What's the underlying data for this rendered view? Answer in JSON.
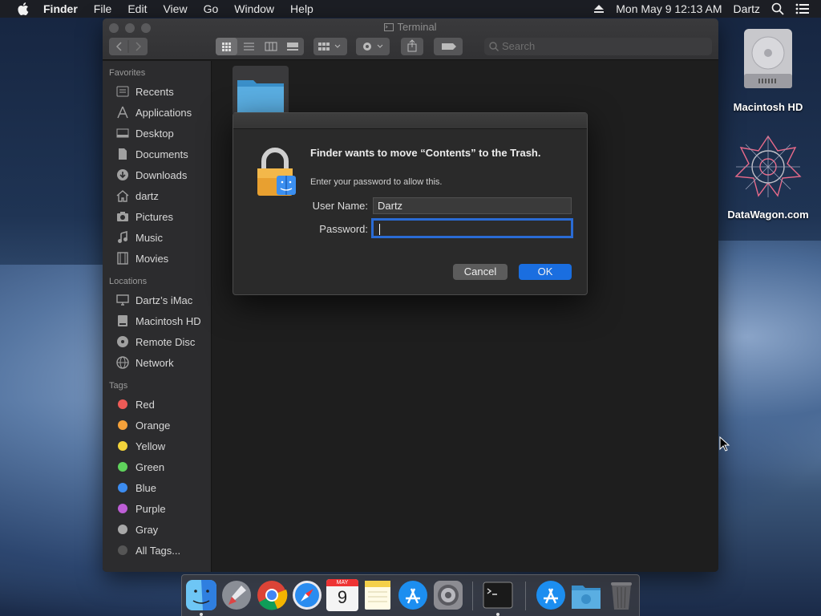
{
  "menubar": {
    "app_name": "Finder",
    "menus": [
      "File",
      "Edit",
      "View",
      "Go",
      "Window",
      "Help"
    ],
    "clock": "Mon May 9  12:13 AM",
    "user": "Dartz"
  },
  "finder": {
    "window_title": "Terminal",
    "search_placeholder": "Search",
    "favorites_heading": "Favorites",
    "favorites": [
      "Recents",
      "Applications",
      "Desktop",
      "Documents",
      "Downloads",
      "dartz",
      "Pictures",
      "Music",
      "Movies"
    ],
    "locations_heading": "Locations",
    "locations": [
      "Dartz’s iMac",
      "Macintosh HD",
      "Remote Disc",
      "Network"
    ],
    "tags_heading": "Tags",
    "tags": [
      {
        "label": "Red",
        "color": "#ee5b57"
      },
      {
        "label": "Orange",
        "color": "#f5a13a"
      },
      {
        "label": "Yellow",
        "color": "#f3d43b"
      },
      {
        "label": "Green",
        "color": "#5fd25c"
      },
      {
        "label": "Blue",
        "color": "#3c8cf0"
      },
      {
        "label": "Purple",
        "color": "#be5ed6"
      },
      {
        "label": "Gray",
        "color": "#a8a8a8"
      },
      {
        "label": "All Tags...",
        "color": "#555555"
      }
    ]
  },
  "dialog": {
    "title": "Finder wants to move “Contents” to the Trash.",
    "subtitle": "Enter your password to allow this.",
    "username_label": "User Name:",
    "username_value": "Dartz",
    "password_label": "Password:",
    "password_value": "",
    "cancel_label": "Cancel",
    "ok_label": "OK",
    "accent": "#1a6ee0"
  },
  "desktop": {
    "icons": [
      {
        "label": "Macintosh HD",
        "icon": "hard-drive-icon"
      },
      {
        "label": "DataWagon.com",
        "icon": "datawagon-logo-icon"
      }
    ]
  },
  "dock": {
    "apps": [
      "Finder",
      "Launchpad",
      "Chrome",
      "Safari",
      "Calendar",
      "Notes",
      "App Store",
      "System Preferences",
      "Terminal",
      "Applications",
      "Downloads",
      "Trash"
    ],
    "calendar_month": "MAY",
    "calendar_day": "9"
  }
}
